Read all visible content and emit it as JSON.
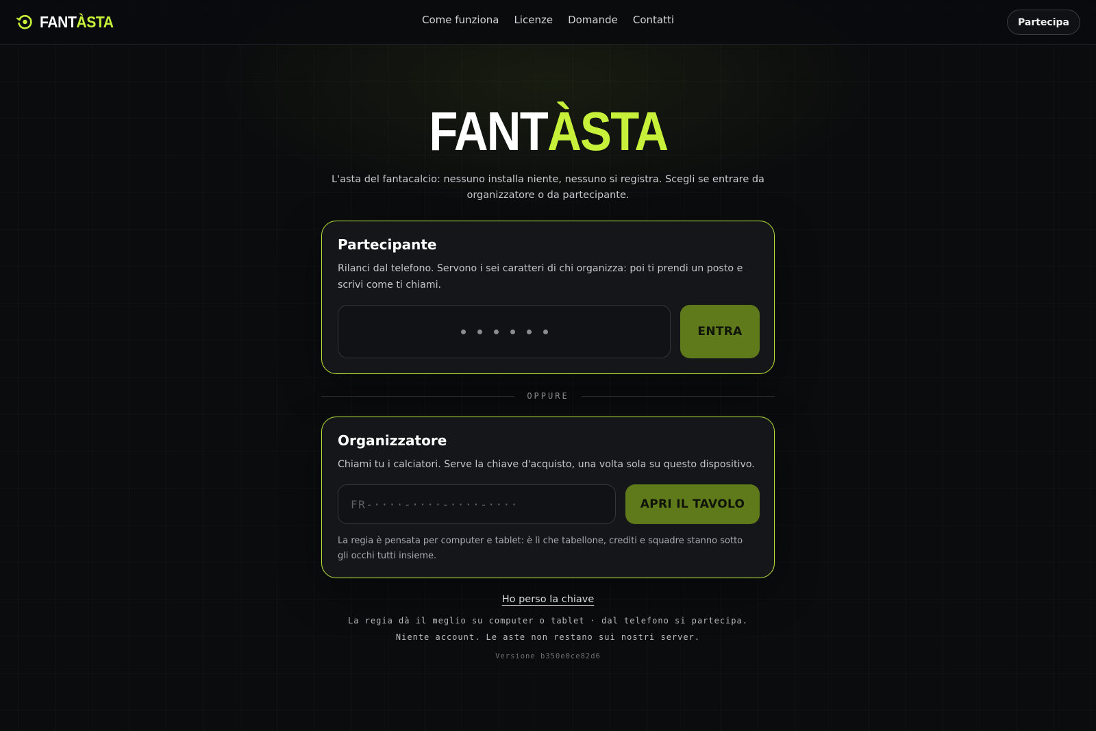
{
  "header": {
    "brand": {
      "part1": "FANT",
      "part2": "ÀSTA"
    },
    "nav": [
      "Come funziona",
      "Licenze",
      "Domande",
      "Contatti"
    ],
    "join_label": "Partecipa"
  },
  "hero": {
    "title_part1": "FANT",
    "title_part2": "ÀSTA",
    "subtitle": "L'asta del fantacalcio: nessuno installa niente, nessuno si registra. Scegli se entrare da organizzatore o da partecipante."
  },
  "participant": {
    "title": "Partecipante",
    "description": "Rilanci dal telefono. Servono i sei caratteri di chi organizza: poi ti prendi un posto e scrivi come ti chiami.",
    "code_placeholder_dots": 6,
    "enter_label": "ENTRA"
  },
  "divider_label": "OPPURE",
  "organizer": {
    "title": "Organizzatore",
    "description": "Chiami tu i calciatori. Serve la chiave d'acquisto, una volta sola su questo dispositivo.",
    "key_placeholder": "FR-····-····-····-····",
    "open_label": "APRI IL TAVOLO",
    "note": "La regia è pensata per computer e tablet: è lì che tabellone, crediti e squadre stanno sotto gli occhi tutti insieme."
  },
  "footer": {
    "lost_key": "Ho perso la chiave",
    "line1": "La regia dà il meglio su computer o tablet · dal telefono si partecipa.",
    "line2": "Niente account. Le aste non restano sui nostri server.",
    "version": "Versione b350e0ce82d6"
  },
  "colors": {
    "accent": "#c6f03a",
    "button": "#5e7a1a",
    "background": "#0b0c0e",
    "card": "#15161a"
  },
  "icons": {
    "brand": "gavel-circle-icon"
  }
}
